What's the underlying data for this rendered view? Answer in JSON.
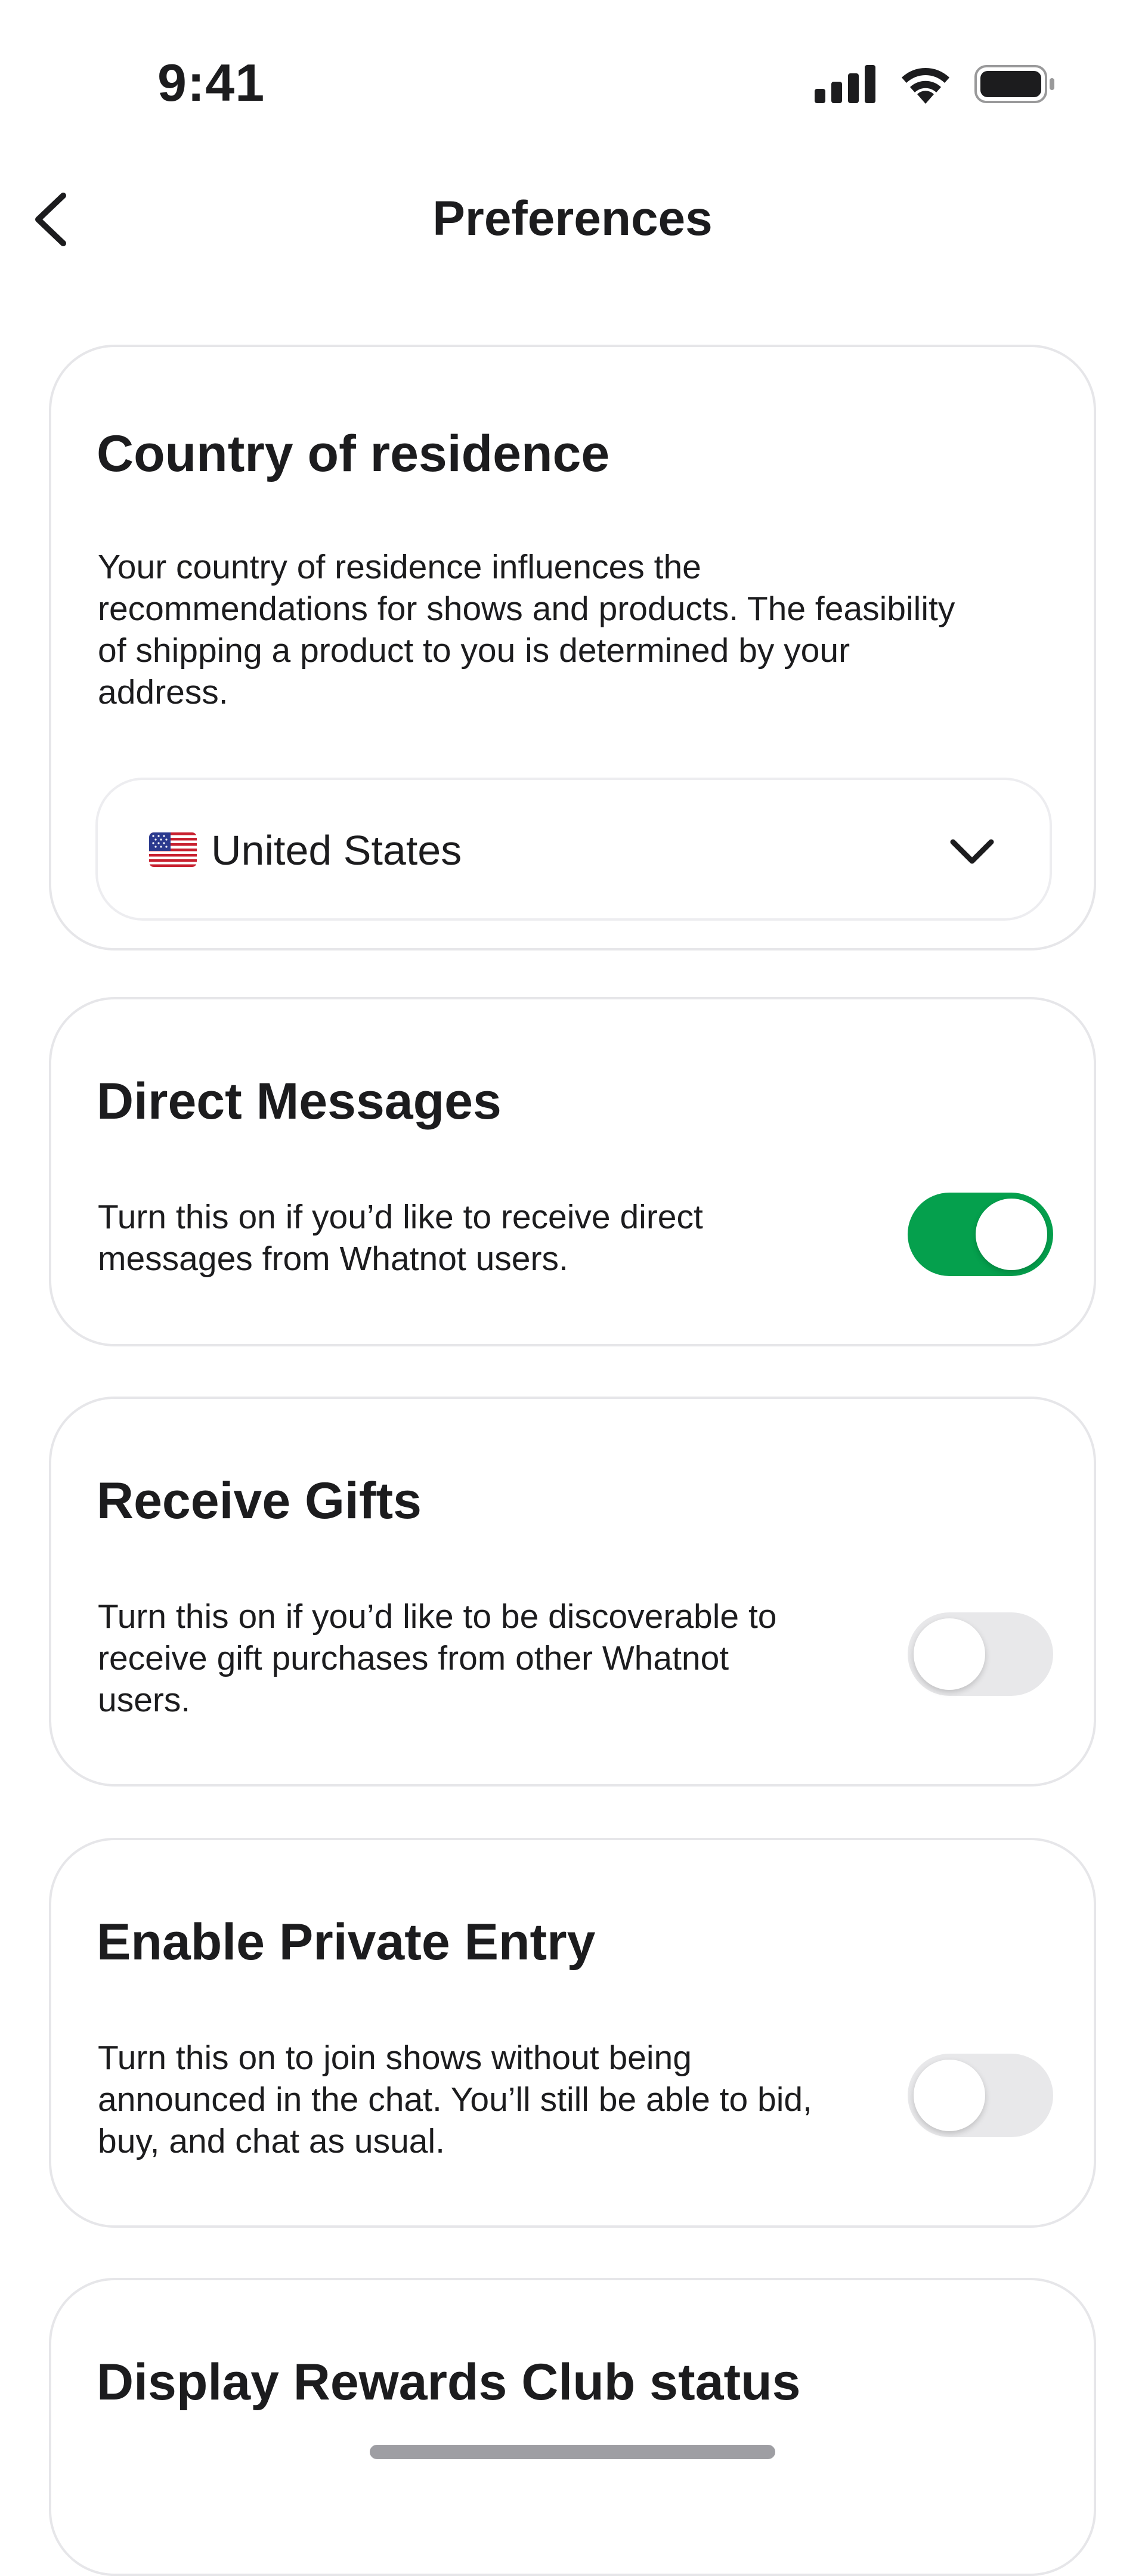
{
  "status_bar": {
    "time": "9:41"
  },
  "nav": {
    "title": "Preferences",
    "back_icon": "chevron-left-icon"
  },
  "country_card": {
    "title": "Country of residence",
    "description_lines": [
      "Your country of residence influences the",
      "recommendations for shows and products. The feasibility",
      "of shipping a product to you is determined by your",
      "address."
    ],
    "selected_country": "United States",
    "flag_icon": "us-flag-icon",
    "dropdown_icon": "chevron-down-icon"
  },
  "direct_messages": {
    "title": "Direct Messages",
    "description_lines": [
      "Turn this on if you’d like to receive direct",
      "messages from Whatnot users."
    ],
    "enabled": true
  },
  "receive_gifts": {
    "title": "Receive Gifts",
    "description_lines": [
      "Turn this on if you’d like to be discoverable to",
      "receive gift purchases from other Whatnot",
      "users."
    ],
    "enabled": false
  },
  "private_entry": {
    "title": "Enable Private Entry",
    "description_lines": [
      "Turn this on to join shows without being",
      "announced in the chat. You’ll still be able to bid,",
      "buy, and chat as usual."
    ],
    "enabled": false
  },
  "rewards_club": {
    "title": "Display Rewards Club status"
  },
  "colors": {
    "toggle_on": "#05a04d",
    "toggle_off": "#e8e8ea",
    "card_border": "#e6e6e9"
  }
}
